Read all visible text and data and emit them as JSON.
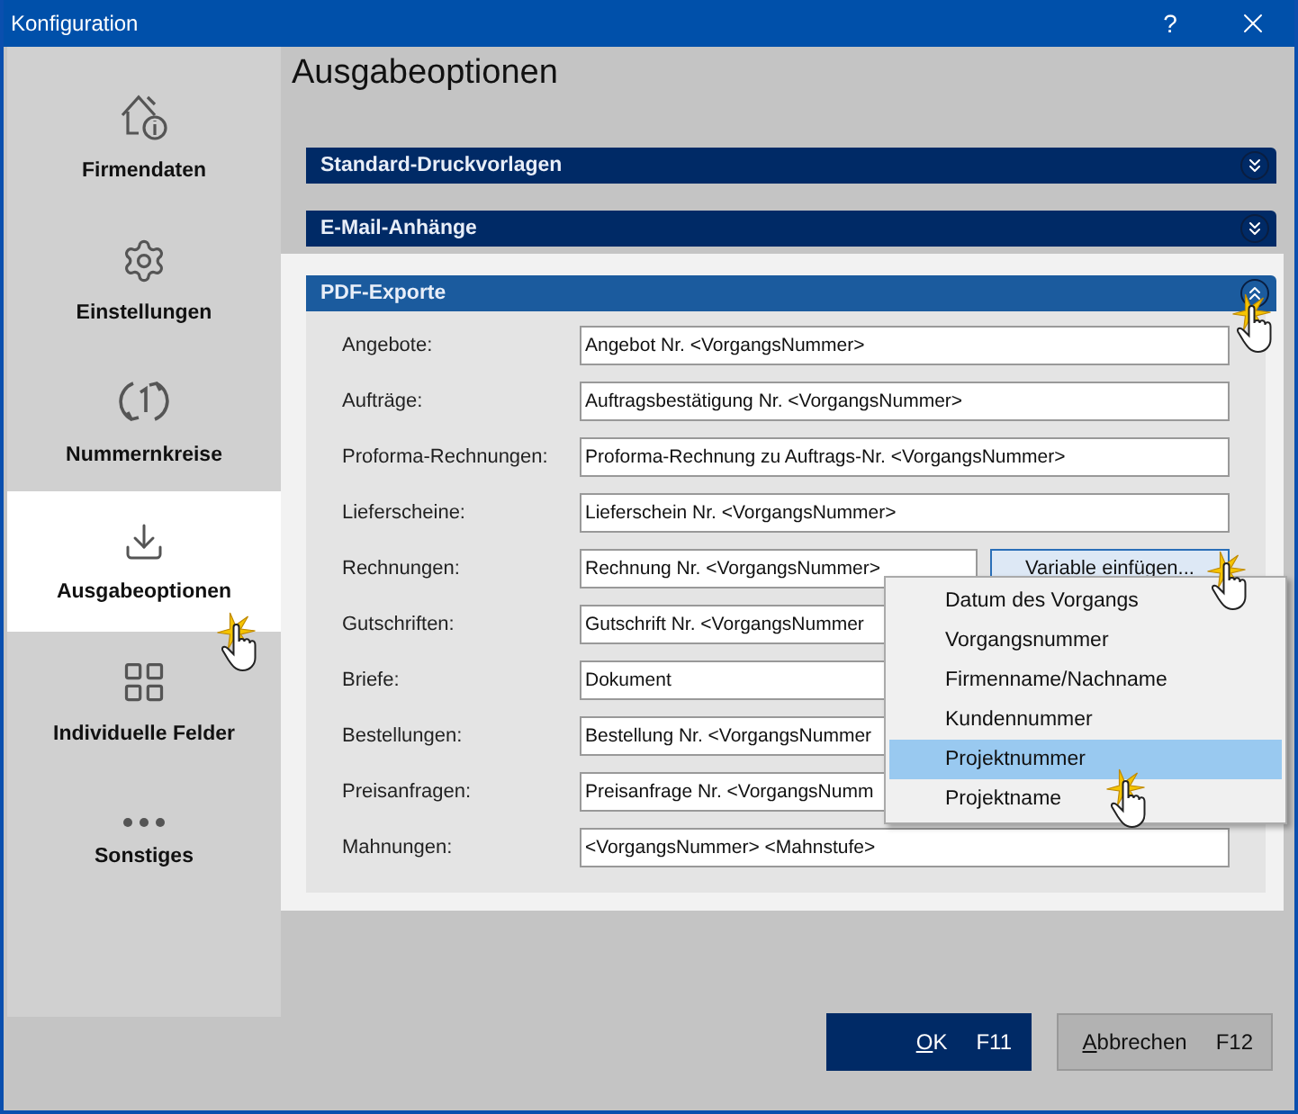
{
  "window": {
    "title": "Konfiguration",
    "help": "?"
  },
  "sidebar": {
    "items": [
      {
        "label": "Firmendaten",
        "selected": false
      },
      {
        "label": "Einstellungen",
        "selected": false
      },
      {
        "label": "Nummernkreise",
        "selected": false
      },
      {
        "label": "Ausgabeoptionen",
        "selected": true
      },
      {
        "label": "Individuelle Felder",
        "selected": false
      },
      {
        "label": "Sonstiges",
        "selected": false
      }
    ]
  },
  "page_title": "Ausgabeoptionen",
  "sections": [
    {
      "title": "Standard-Druckvorlagen",
      "expanded": false
    },
    {
      "title": "E-Mail-Anhänge",
      "expanded": false
    },
    {
      "title": "PDF-Exporte",
      "expanded": true,
      "fields": [
        {
          "label": "Angebote:",
          "value": "Angebot Nr. <VorgangsNummer>"
        },
        {
          "label": "Aufträge:",
          "value": "Auftragsbestätigung Nr. <VorgangsNummer>"
        },
        {
          "label": "Proforma-Rechnungen:",
          "value": "Proforma-Rechnung zu Auftrags-Nr. <VorgangsNummer>"
        },
        {
          "label": "Lieferscheine:",
          "value": "Lieferschein Nr. <VorgangsNummer>"
        },
        {
          "label": "Rechnungen:",
          "value": "Rechnung Nr. <VorgangsNummer>",
          "button": "Variable einfügen..."
        },
        {
          "label": "Gutschriften:",
          "value": "Gutschrift Nr. <VorgangsNummer"
        },
        {
          "label": "Briefe:",
          "value": "Dokument"
        },
        {
          "label": "Bestellungen:",
          "value": "Bestellung Nr. <VorgangsNummer"
        },
        {
          "label": "Preisanfragen:",
          "value": "Preisanfrage Nr. <VorgangsNumm"
        },
        {
          "label": "Mahnungen:",
          "value": "<VorgangsNummer> <Mahnstufe>"
        }
      ]
    }
  ],
  "variable_menu": {
    "items": [
      {
        "label": "Datum des Vorgangs",
        "selected": false
      },
      {
        "label": "Vorgangsnummer",
        "selected": false
      },
      {
        "label": "Firmenname/Nachname",
        "selected": false
      },
      {
        "label": "Kundennummer",
        "selected": false
      },
      {
        "label": "Projektnummer",
        "selected": true
      },
      {
        "label": "Projektname",
        "selected": false
      }
    ]
  },
  "buttons": [
    {
      "label": "OK",
      "shortcut": "F11",
      "kind": "primary"
    },
    {
      "label": "Abbrechen",
      "shortcut": "F12",
      "kind": "secondary"
    }
  ]
}
